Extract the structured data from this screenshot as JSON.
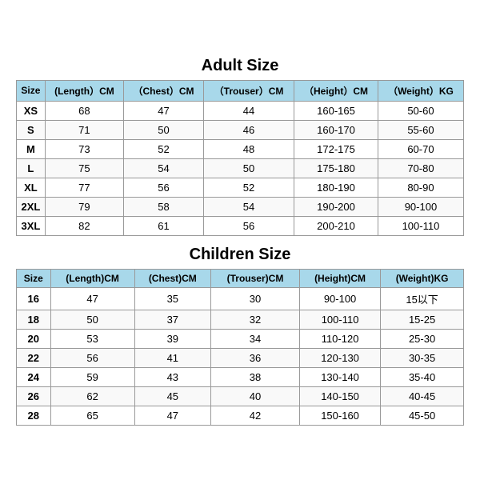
{
  "adult": {
    "title": "Adult Size",
    "headers": [
      "Size",
      "(Length）CM",
      "（Chest）CM",
      "（Trouser）CM",
      "（Height）CM",
      "（Weight）KG"
    ],
    "rows": [
      [
        "XS",
        "68",
        "47",
        "44",
        "160-165",
        "50-60"
      ],
      [
        "S",
        "71",
        "50",
        "46",
        "160-170",
        "55-60"
      ],
      [
        "M",
        "73",
        "52",
        "48",
        "172-175",
        "60-70"
      ],
      [
        "L",
        "75",
        "54",
        "50",
        "175-180",
        "70-80"
      ],
      [
        "XL",
        "77",
        "56",
        "52",
        "180-190",
        "80-90"
      ],
      [
        "2XL",
        "79",
        "58",
        "54",
        "190-200",
        "90-100"
      ],
      [
        "3XL",
        "82",
        "61",
        "56",
        "200-210",
        "100-110"
      ]
    ]
  },
  "children": {
    "title": "Children Size",
    "headers": [
      "Size",
      "(Length)CM",
      "(Chest)CM",
      "(Trouser)CM",
      "(Height)CM",
      "(Weight)KG"
    ],
    "rows": [
      [
        "16",
        "47",
        "35",
        "30",
        "90-100",
        "15以下"
      ],
      [
        "18",
        "50",
        "37",
        "32",
        "100-110",
        "15-25"
      ],
      [
        "20",
        "53",
        "39",
        "34",
        "110-120",
        "25-30"
      ],
      [
        "22",
        "56",
        "41",
        "36",
        "120-130",
        "30-35"
      ],
      [
        "24",
        "59",
        "43",
        "38",
        "130-140",
        "35-40"
      ],
      [
        "26",
        "62",
        "45",
        "40",
        "140-150",
        "40-45"
      ],
      [
        "28",
        "65",
        "47",
        "42",
        "150-160",
        "45-50"
      ]
    ]
  }
}
